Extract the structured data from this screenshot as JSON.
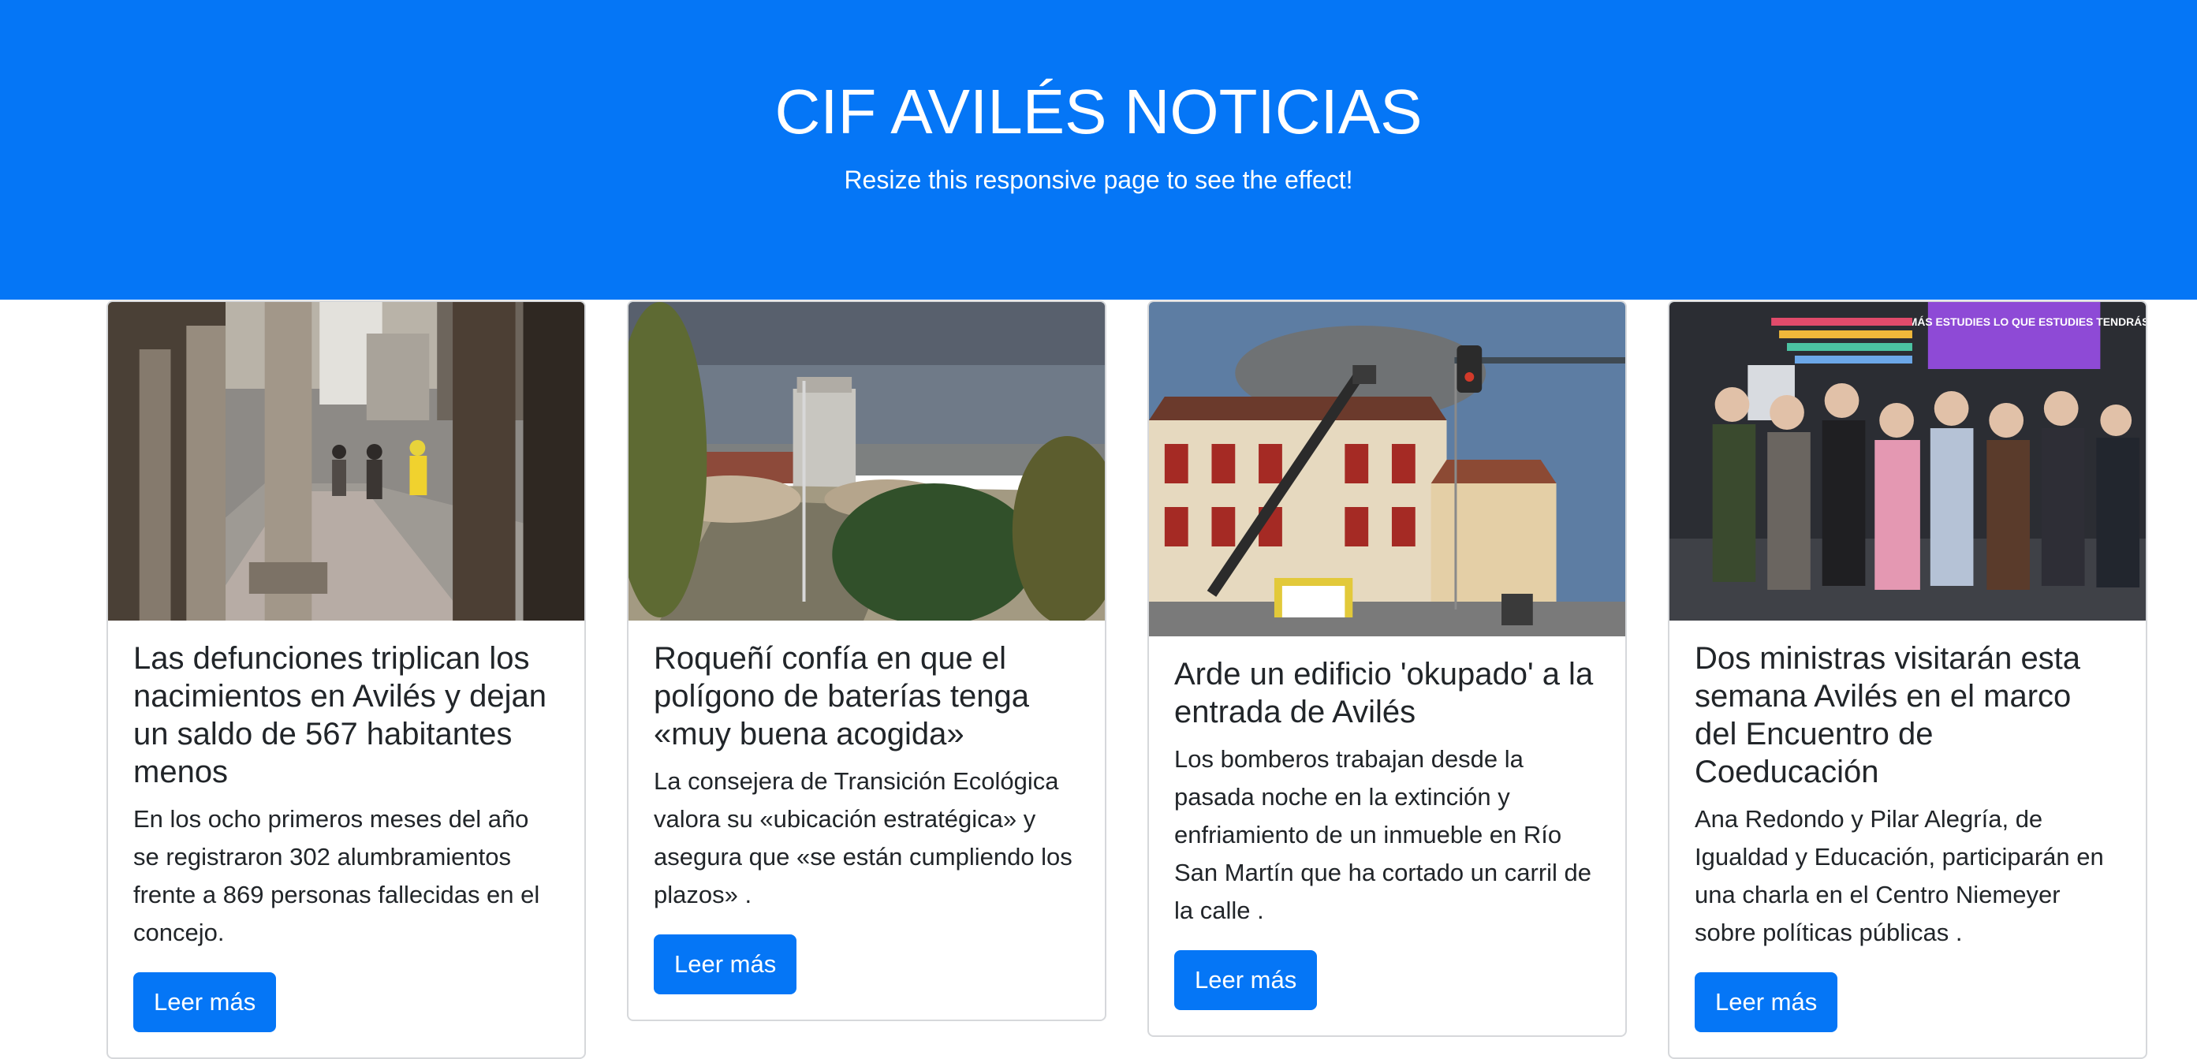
{
  "header": {
    "title": "CIF AVILÉS NOTICIAS",
    "subtitle": "Resize this responsive page to see the effect!"
  },
  "colors": {
    "accent": "#0576f6",
    "card_border": "#d6d8db",
    "text": "#212529"
  },
  "cards": [
    {
      "image_name": "arcade-street-photo",
      "title": "Las defunciones triplican los nacimientos en Avilés y dejan un saldo de 567 habitantes menos",
      "text": "En los ocho primeros meses del año se registraron 302 alumbramientos frente a 869 personas fallecidas en el concejo.",
      "button_label": "Leer más"
    },
    {
      "image_name": "industrial-site-photo",
      "title": "Roqueñí confía en que el polígono de baterías tenga «muy buena acogida»",
      "text": "La consejera de Transición Ecológica valora su «ubicación estratégica» y asegura que «se están cumpliendo los plazos» .",
      "button_label": "Leer más"
    },
    {
      "image_name": "building-fire-photo",
      "title": "Arde un edificio 'okupado' a la entrada de Avilés",
      "text": "Los bomberos trabajan desde la pasada noche en la extinción y enfriamiento de un inmueble en Río San Martín que ha cortado un carril de la calle .",
      "button_label": "Leer más"
    },
    {
      "image_name": "group-event-photo",
      "title": "Dos ministras visitarán esta semana Avilés en el marco del Encuentro de Coeducación",
      "text": "Ana Redondo y Pilar Alegría, de Igualdad y Educación, participarán en una charla en el Centro Niemeyer sobre políticas públicas .",
      "button_label": "Leer más",
      "image_banner": "Y ADEMÁS ESTUDIES LO QUE ESTUDIES TENDRÁS:"
    }
  ]
}
